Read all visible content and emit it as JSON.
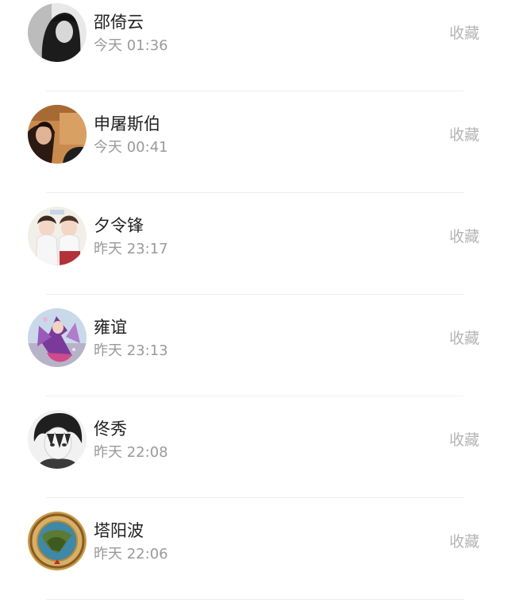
{
  "contacts": [
    {
      "name": "邵倚云",
      "time": "今天 01:36",
      "action": "收藏"
    },
    {
      "name": "申屠斯伯",
      "time": "今天 00:41",
      "action": "收藏"
    },
    {
      "name": "夕令锋",
      "time": "昨天 23:17",
      "action": "收藏"
    },
    {
      "name": "雍谊",
      "time": "昨天 23:13",
      "action": "收藏"
    },
    {
      "name": "佟秀",
      "time": "昨天 22:08",
      "action": "收藏"
    },
    {
      "name": "塔阳波",
      "time": "昨天 22:06",
      "action": "收藏"
    }
  ]
}
